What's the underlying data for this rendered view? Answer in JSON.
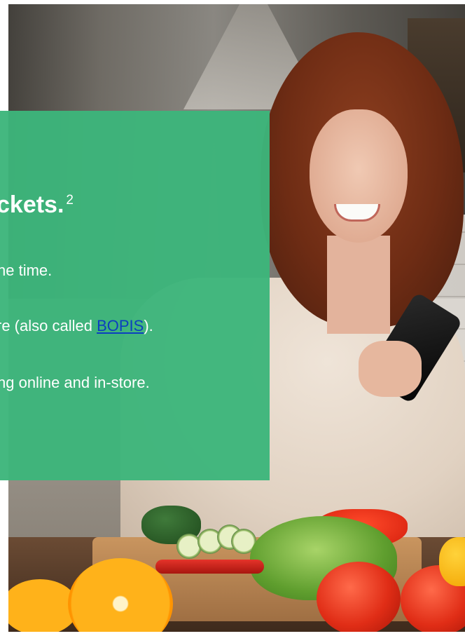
{
  "panel": {
    "color": "#3cb57b",
    "heading": "ckets.",
    "heading_superscript": "2",
    "line1": "ne time.",
    "line2_before": "re (also called ",
    "line2_link": "BOPIS",
    "line2_after": ").",
    "line3": "ng online and in-store."
  },
  "link_color": "#0b3fbf",
  "photo": {
    "subject": "woman-smiling-using-smartphone-in-kitchen"
  }
}
